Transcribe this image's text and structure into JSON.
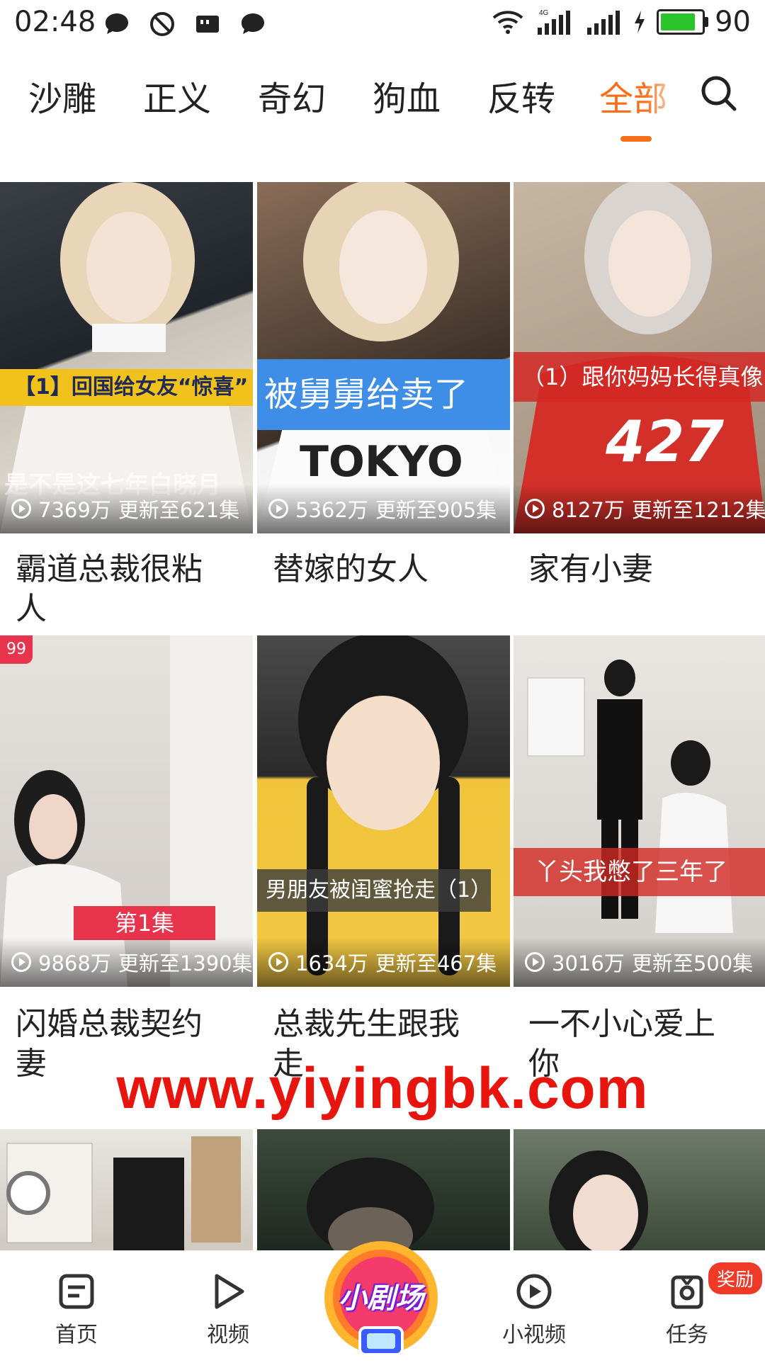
{
  "status": {
    "time": "02:48",
    "battery": "90",
    "network": "4G"
  },
  "tabs": [
    "沙雕",
    "正义",
    "奇幻",
    "狗血",
    "反转",
    "全部"
  ],
  "active_tab": "全部",
  "cards": [
    {
      "views": "7369万",
      "update": "更新至621集",
      "title": "霸道总裁很粘人",
      "caption": "【1】回国给女友“惊喜”",
      "sub": "是不是这七年白晓月"
    },
    {
      "views": "5362万",
      "update": "更新至905集",
      "title": "替嫁的女人",
      "caption": "被舅舅给卖了",
      "shirt": "TOKYO"
    },
    {
      "views": "8127万",
      "update": "更新至1212集",
      "title": "家有小妻",
      "caption": "（1）跟你妈妈长得真像",
      "shirt": "427"
    },
    {
      "views": "9868万",
      "update": "更新至1390集",
      "title": "闪婚总裁契约妻",
      "caption": "第1集",
      "badge": "99"
    },
    {
      "views": "1634万",
      "update": "更新至467集",
      "title": "总裁先生跟我走",
      "caption": "男朋友被闺蜜抢走（1）"
    },
    {
      "views": "3016万",
      "update": "更新至500集",
      "title": "一不小心爱上你",
      "caption": "丫头我憋了三年了"
    }
  ],
  "watermark": "www.yiyingbk.com",
  "nav": {
    "home": "首页",
    "video": "视频",
    "center": "小剧场",
    "short": "小视频",
    "task": "任务",
    "task_badge": "奖励"
  },
  "colors": {
    "accent": "#f6701c",
    "watermark": "#e8150f",
    "badge": "#f03a28"
  }
}
